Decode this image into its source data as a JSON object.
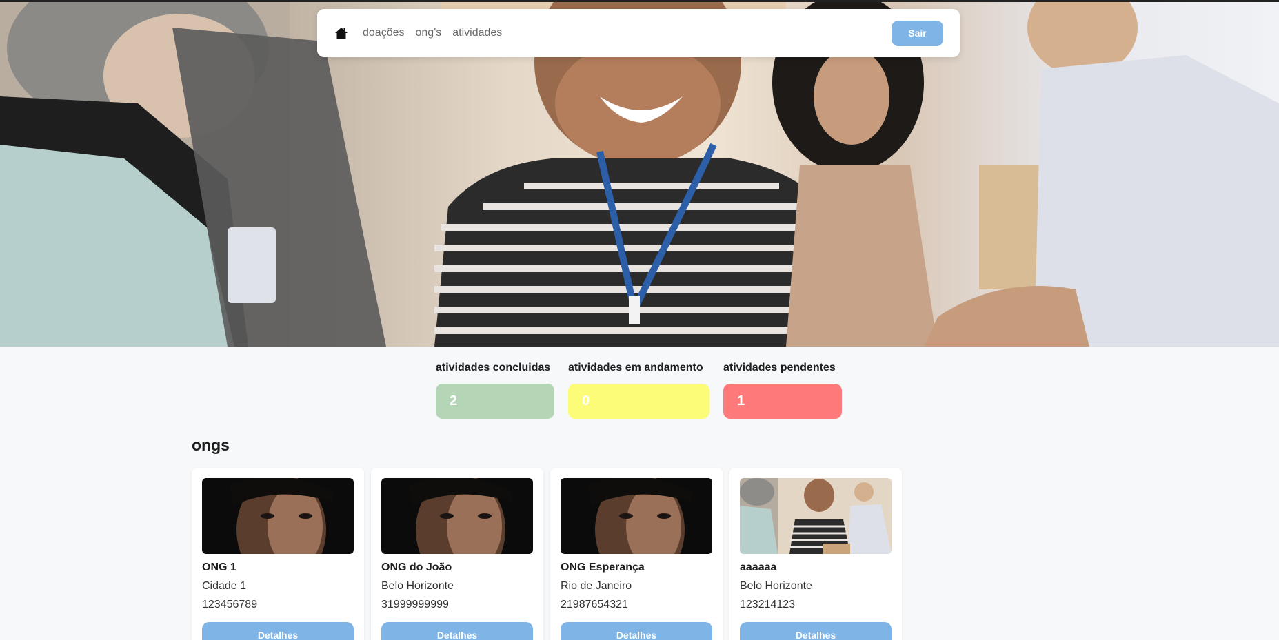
{
  "nav": {
    "home_icon": "home-icon",
    "links": [
      "doações",
      "ong's",
      "atividades"
    ],
    "logout_label": "Sair"
  },
  "stats": [
    {
      "label": "atividades concluidas",
      "value": "2",
      "color": "#b5d6b6"
    },
    {
      "label": "atividades em andamento",
      "value": "0",
      "color": "#fdfc79"
    },
    {
      "label": "atividades pendentes",
      "value": "1",
      "color": "#fe7a7a"
    }
  ],
  "ongs": {
    "title": "ongs",
    "items": [
      {
        "name": "ONG 1",
        "city": "Cidade 1",
        "phone": "123456789",
        "button": "Detalhes",
        "image": "portrait"
      },
      {
        "name": "ONG do João",
        "city": "Belo Horizonte",
        "phone": "31999999999",
        "button": "Detalhes",
        "image": "portrait"
      },
      {
        "name": "ONG Esperança",
        "city": "Rio de Janeiro",
        "phone": "21987654321",
        "button": "Detalhes",
        "image": "portrait"
      },
      {
        "name": "aaaaaa",
        "city": "Belo Horizonte",
        "phone": "123214123",
        "button": "Detalhes",
        "image": "volunteers"
      }
    ]
  },
  "colors": {
    "accent": "#7fb4e6",
    "background": "#f6f8fa"
  }
}
